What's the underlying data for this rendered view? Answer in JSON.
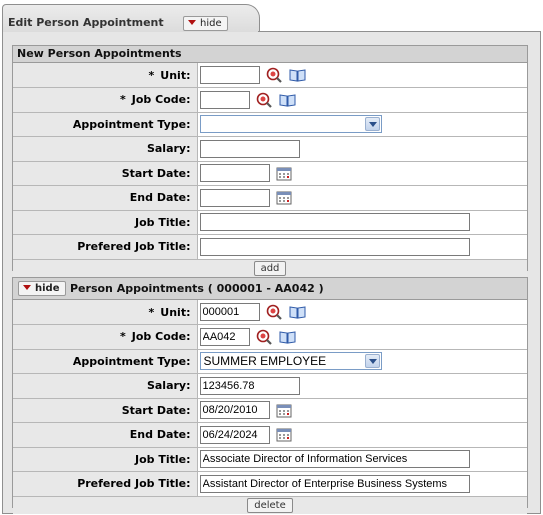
{
  "tab": {
    "title": "Edit Person Appointment",
    "hide_label": "hide"
  },
  "new_section": {
    "title": "New Person Appointments",
    "fields": {
      "unit_label": "Unit:",
      "unit_value": "",
      "job_code_label": "Job Code:",
      "job_code_value": "",
      "appt_type_label": "Appointment Type:",
      "appt_type_value": "",
      "salary_label": "Salary:",
      "salary_value": "",
      "start_date_label": "Start Date:",
      "start_date_value": "",
      "end_date_label": "End Date:",
      "end_date_value": "",
      "job_title_label": "Job Title:",
      "job_title_value": "",
      "pref_job_title_label": "Prefered Job Title:",
      "pref_job_title_value": ""
    },
    "required_marker": "*",
    "add_label": "add"
  },
  "existing_section": {
    "hide_label": "hide",
    "title": "Person Appointments ( 000001 - AA042 )",
    "fields": {
      "unit_label": "Unit:",
      "unit_value": "000001",
      "job_code_label": "Job Code:",
      "job_code_value": "AA042",
      "appt_type_label": "Appointment Type:",
      "appt_type_value": "SUMMER EMPLOYEE",
      "salary_label": "Salary:",
      "salary_value": "123456.78",
      "start_date_label": "Start Date:",
      "start_date_value": "08/20/2010",
      "end_date_label": "End Date:",
      "end_date_value": "06/24/2024",
      "job_title_label": "Job Title:",
      "job_title_value": "Associate Director of Information Services",
      "pref_job_title_label": "Prefered Job Title:",
      "pref_job_title_value": "Assistant Director of Enterprise Business Systems"
    },
    "required_marker": "*",
    "delete_label": "delete"
  },
  "icons": [
    "search-icon",
    "lookup-book-icon",
    "calendar-icon",
    "hide-triangle-icon",
    "dropdown-arrow-icon"
  ],
  "colors": {
    "accent_red": "#b01010",
    "header_gray": "#d3d3d3",
    "label_bg": "#e8e8e8"
  }
}
